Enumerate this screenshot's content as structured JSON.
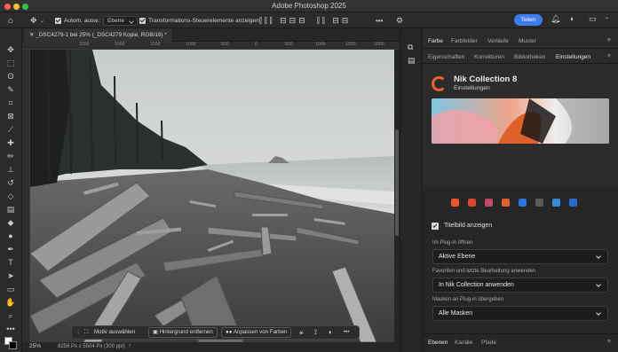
{
  "app": {
    "title": "Adobe Photoshop 2025"
  },
  "options_bar": {
    "auto_select_label": "Autom. ausw.:",
    "auto_select_value": "Ebene",
    "transform_controls_label": "Transformations-Steuerelemente anzeigen",
    "more": "•••",
    "share_label": "Teilen"
  },
  "document": {
    "tab_title": "_DSC4279-1 bei 25% (_DSC4279 Kopie, RGB/16) *",
    "zoom": "25%",
    "dimensions": "8256 Px x 5504 Px (300 ppi)",
    "ruler_h": [
      "2500",
      "2000",
      "1500",
      "1000",
      "500",
      "0",
      "500",
      "1000",
      "1500",
      "2000",
      "2500"
    ],
    "ruler_v": [
      "2",
      "1",
      "5",
      "1",
      "0",
      "5",
      "1",
      "0",
      "5",
      "0",
      "0",
      "5"
    ]
  },
  "contextual_bar": {
    "subject": "Motiv auswählen",
    "remove_bg": "Hintergrund entfernen",
    "match_colors": "Anpassen von Farben",
    "more": "•••"
  },
  "panel": {
    "top_tabs": [
      "Farbe",
      "Farbfelder",
      "Verläufe",
      "Muster"
    ],
    "second_tabs": [
      "Eigenschaften",
      "Korrekturen",
      "Bibliotheken",
      "Einstellungen"
    ],
    "bottom_tabs": [
      "Ebenen",
      "Kanäle",
      "Pfade"
    ]
  },
  "nik": {
    "title": "Nik Collection 8",
    "subtitle": "Einstellungen",
    "show_header_label": "Titelbild anzeigen",
    "open_label": "Im Plug-in öffnen",
    "open_value": "Aktive Ebene",
    "favorites_label": "Favoriten und letzte Bearbeitung anwenden",
    "favorites_value": "In Nik Collection anwenden",
    "masks_label": "Masken an Plug-in übergeben",
    "masks_value": "Alle Masken",
    "app_icon_colors": [
      "#e8562a",
      "#d8482a",
      "#c24a6a",
      "#e0602a",
      "#2e73d8",
      "#5a5a5a",
      "#3a8ad8",
      "#2a6ad0"
    ]
  }
}
